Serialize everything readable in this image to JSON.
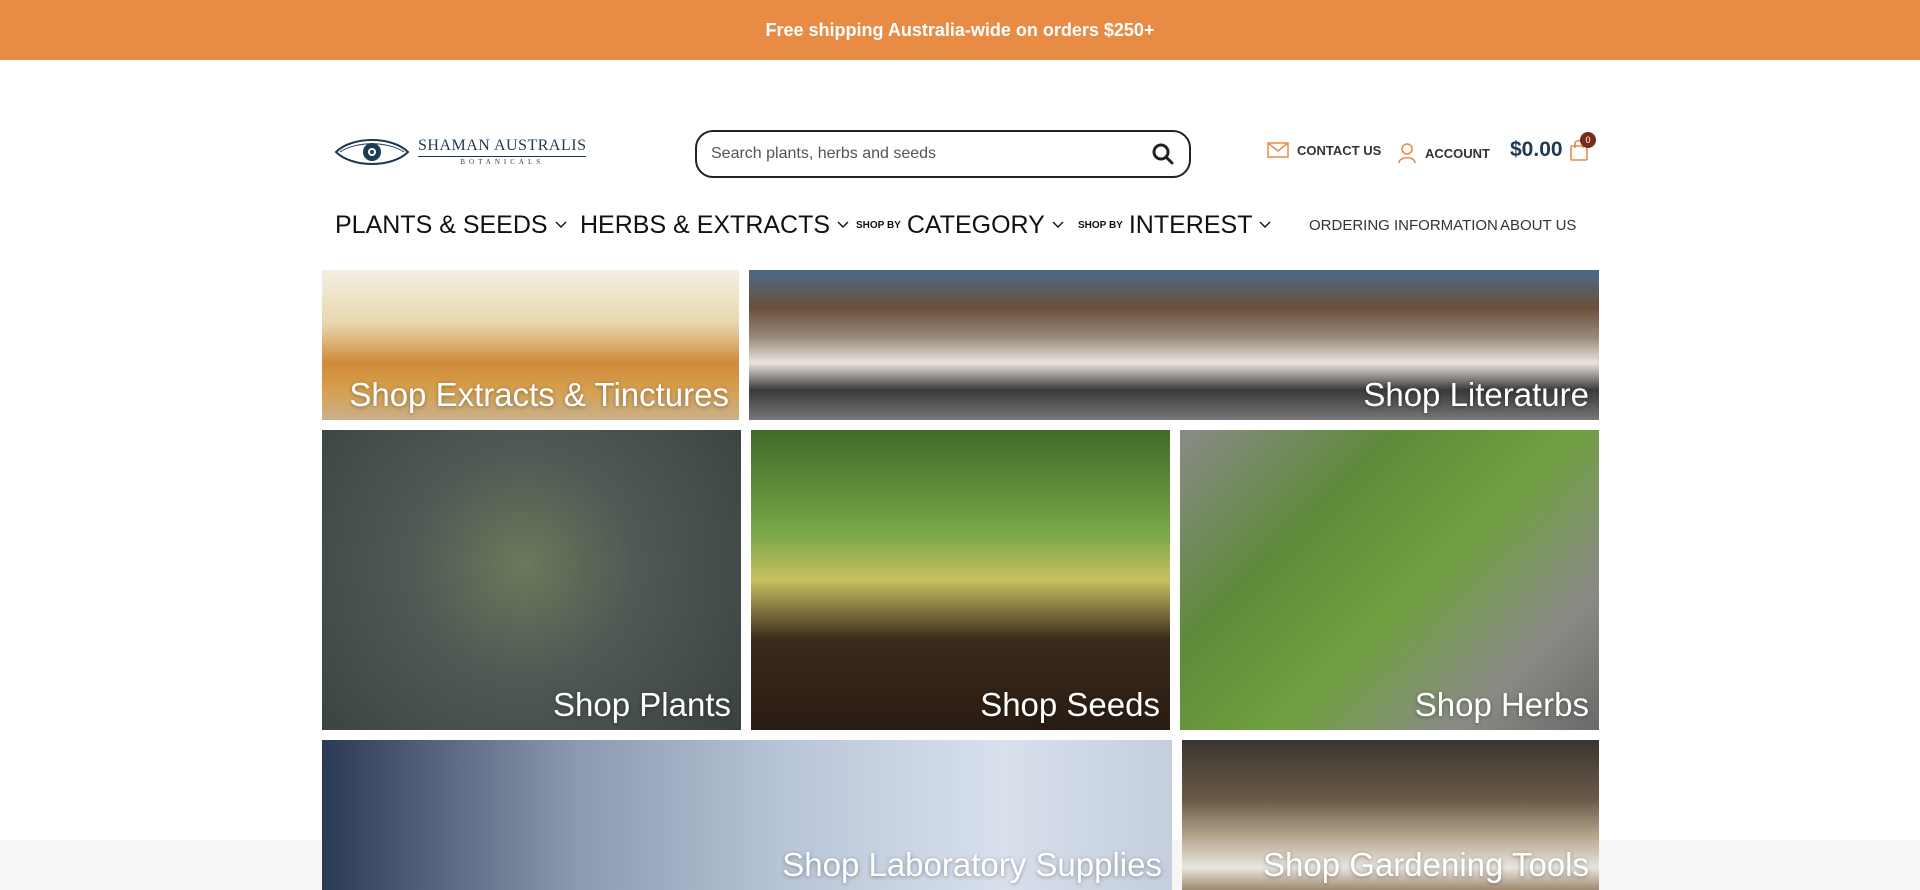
{
  "topbar": {
    "text": "Free shipping Australia-wide on orders $250+"
  },
  "logo": {
    "name": "SHAMAN AUSTRALIS",
    "sub": "BOTANICALS"
  },
  "search": {
    "placeholder": "Search plants, herbs and seeds"
  },
  "header_links": {
    "contact": "CONTACT US",
    "account": "ACCOUNT"
  },
  "cart": {
    "total": "$0.00",
    "count": "0"
  },
  "nav": {
    "plants_seeds": "PLANTS & SEEDS",
    "herbs_extracts": "HERBS & EXTRACTS",
    "shop_by": "SHOP BY",
    "category": "CATEGORY",
    "interest": "INTEREST",
    "ordering": "ORDERING INFORMATION",
    "about": "ABOUT US"
  },
  "tiles": {
    "extracts": "Shop Extracts & Tinctures",
    "literature": "Shop Literature",
    "plants": "Shop Plants",
    "seeds": "Shop Seeds",
    "herbs": "Shop Herbs",
    "lab": "Shop Laboratory Supplies",
    "tools": "Shop Gardening Tools"
  },
  "colors": {
    "accent": "#e88c45",
    "brand": "#1d3a55",
    "badge": "#7a2a1a"
  },
  "icons": [
    "search-icon",
    "envelope-icon",
    "user-icon",
    "shopping-bag-icon",
    "chevron-down-icon",
    "eye-logo-icon"
  ]
}
